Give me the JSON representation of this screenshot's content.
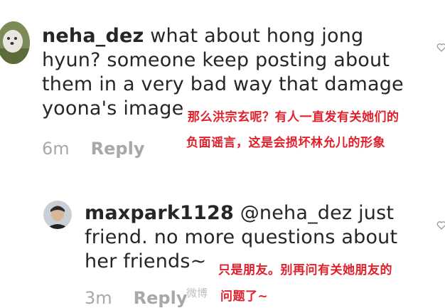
{
  "comments": [
    {
      "username": "neha_dez",
      "line1": " what about hong jong",
      "line2": "hyun? someone keep posting about",
      "line3": "them in a very bad way that damage",
      "line4": "yoona's image",
      "time": "6m",
      "reply_label": "Reply",
      "annotation_line1": "那么洪宗玄呢？有人一直发有关她们的",
      "annotation_line2": "负面谣言，这是会损坏林允儿的形象"
    },
    {
      "username": "maxpark1128",
      "mention": " @neha_dez",
      "line1_rest": " just",
      "line2": "friend. no more questions about",
      "line3": "her friends~",
      "time": "3m",
      "reply_label": "Reply",
      "annotation_line1": "只是朋友。别再问有关她朋友的",
      "annotation_line2": "问题了~"
    }
  ],
  "watermark": "微博"
}
